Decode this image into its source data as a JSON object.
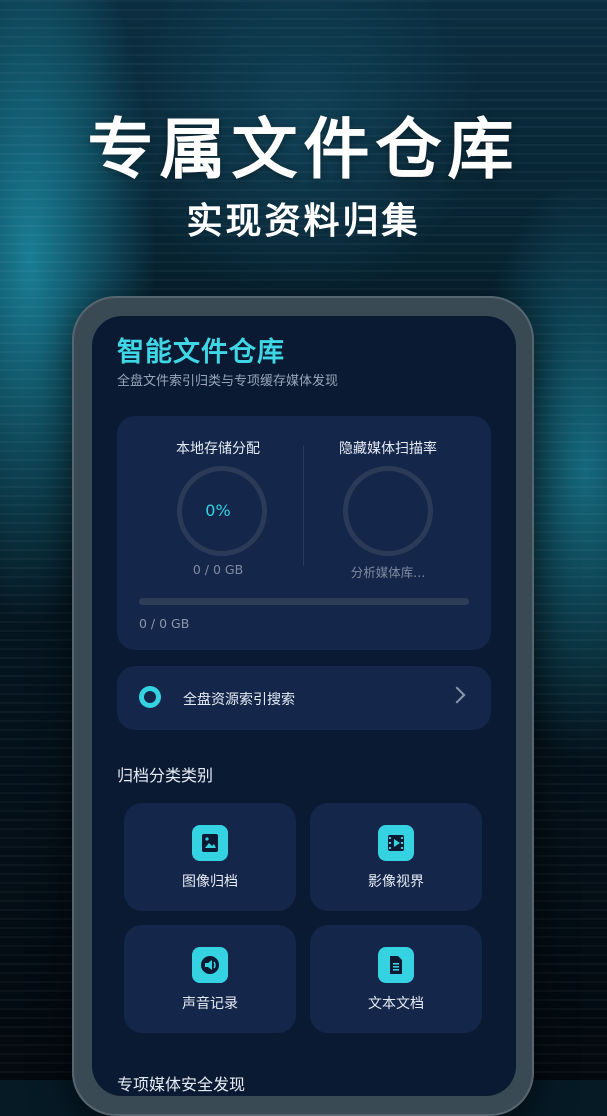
{
  "promo": {
    "headline": "专属文件仓库",
    "subheadline": "实现资料归集"
  },
  "app": {
    "title": "智能文件仓库",
    "subtitle": "全盘文件索引归类与专项缓存媒体发现"
  },
  "storage": {
    "local_label": "本地存储分配",
    "local_percent": "0%",
    "local_usage": "0 / 0 GB",
    "scan_label": "隐藏媒体扫描率",
    "scan_status": "分析媒体库...",
    "bar_caption": "0 / 0 GB",
    "bar_fraction": 0
  },
  "search": {
    "label": "全盘资源索引搜索",
    "icon": "search-icon"
  },
  "categories": {
    "title": "归档分类类别",
    "items": [
      {
        "label": "图像归档",
        "icon": "image-icon"
      },
      {
        "label": "影像视界",
        "icon": "video-icon"
      },
      {
        "label": "声音记录",
        "icon": "audio-icon"
      },
      {
        "label": "文本文档",
        "icon": "document-icon"
      }
    ]
  },
  "next_section": {
    "title": "专项媒体安全发现"
  },
  "colors": {
    "accent": "#35d3e2",
    "card": "#14264a",
    "screen": "#0b1a33"
  }
}
